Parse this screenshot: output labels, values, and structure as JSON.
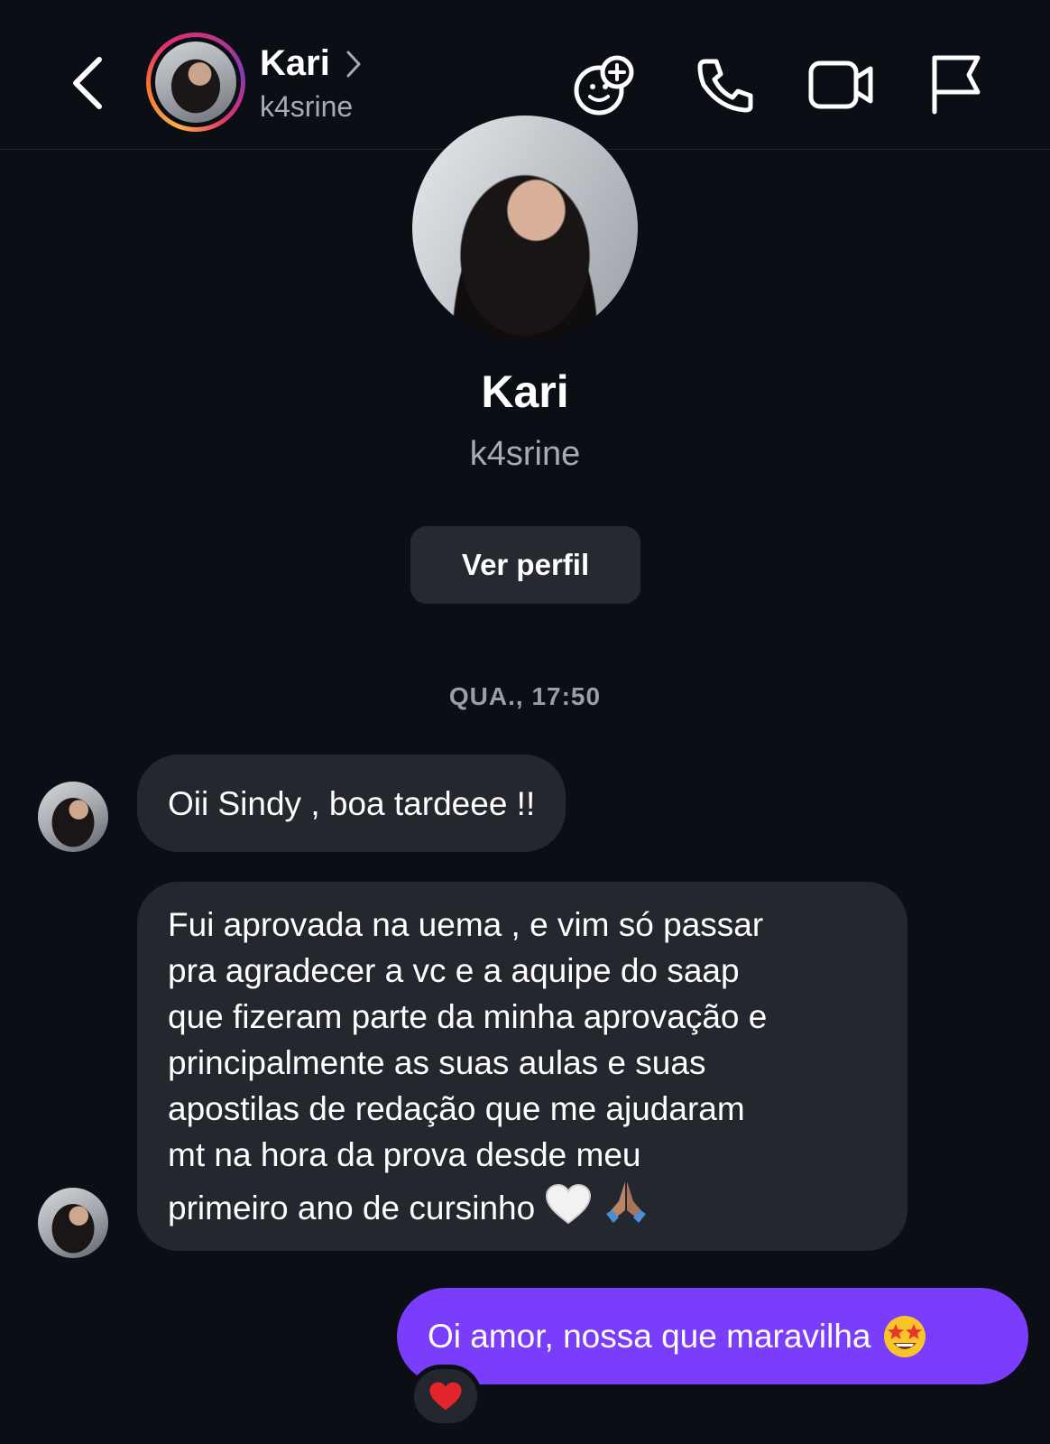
{
  "header": {
    "back_icon": "chevron-left-icon",
    "name": "Kari",
    "username": "k4srine",
    "actions": [
      "add-effect-icon",
      "phone-icon",
      "video-camera-icon",
      "flag-icon"
    ]
  },
  "profile": {
    "name": "Kari",
    "username": "k4srine",
    "view_profile_label": "Ver perfil"
  },
  "conversation": {
    "timestamp": "QUA., 17:50",
    "messages": [
      {
        "from": "Kari",
        "text": "Oii Sindy , boa tardeee !!"
      },
      {
        "from": "Kari",
        "lines": [
          "Fui aprovada na uema , e vim só passar",
          "pra agradecer a  vc e a aquipe do saap",
          "que fizeram parte da minha aprovação e",
          "principalmente as suas aulas e suas",
          "apostilas  de redação que me ajudaram",
          "mt na hora da prova  desde meu",
          "primeiro ano de cursinho"
        ],
        "emojis": [
          "white-heart-icon",
          "folded-hands-icon"
        ]
      },
      {
        "from": "me",
        "text": "Oi amor, nossa que maravilha",
        "emoji": "star-struck-icon",
        "reaction": "red-heart-icon"
      }
    ]
  },
  "colors": {
    "background": "#0c0e15",
    "incoming_bubble": "#25272e",
    "outgoing_bubble": "#7a3dfc",
    "secondary_text": "#a8abb4"
  }
}
